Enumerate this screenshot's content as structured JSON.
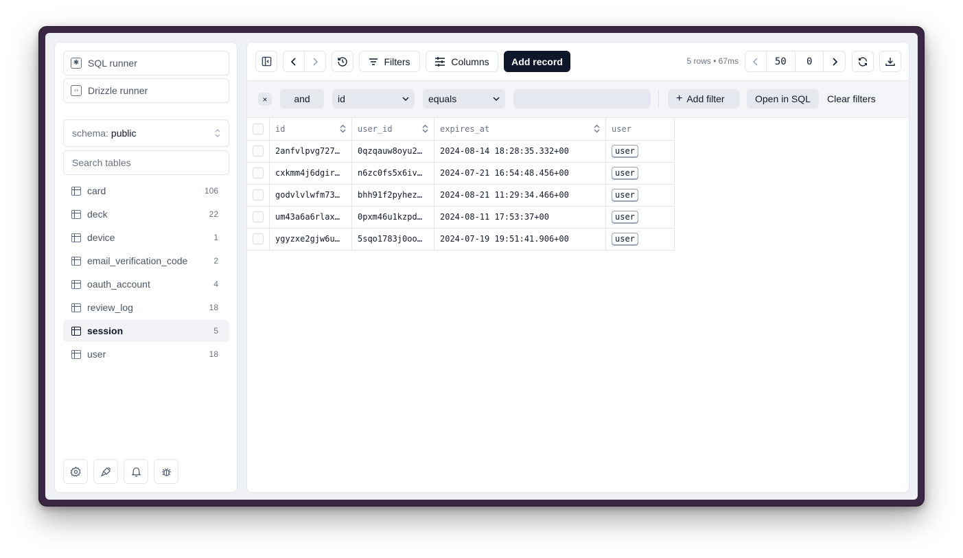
{
  "sidebar": {
    "sql_runner": "SQL runner",
    "drizzle_runner": "Drizzle runner",
    "schema_label": "schema:",
    "schema_value": "public",
    "search_placeholder": "Search tables",
    "tables": [
      {
        "name": "card",
        "count": "106",
        "active": false
      },
      {
        "name": "deck",
        "count": "22",
        "active": false
      },
      {
        "name": "device",
        "count": "1",
        "active": false
      },
      {
        "name": "email_verification_code",
        "count": "2",
        "active": false
      },
      {
        "name": "oauth_account",
        "count": "4",
        "active": false
      },
      {
        "name": "review_log",
        "count": "18",
        "active": false
      },
      {
        "name": "session",
        "count": "5",
        "active": true
      },
      {
        "name": "user",
        "count": "18",
        "active": false
      }
    ],
    "bottom_icons": [
      "settings-icon",
      "brush-icon",
      "bell-icon",
      "bug-icon"
    ]
  },
  "toolbar": {
    "filters_label": "Filters",
    "columns_label": "Columns",
    "add_record_label": "Add record",
    "status": "5 rows • 67ms",
    "limit": "50",
    "offset": "0"
  },
  "filter": {
    "conjunction": "and",
    "column": "id",
    "operator": "equals",
    "value": "",
    "add_filter_label": "Add filter",
    "open_in_sql_label": "Open in SQL",
    "clear_filters_label": "Clear filters"
  },
  "grid": {
    "columns": [
      "id",
      "user_id",
      "expires_at",
      "user"
    ],
    "rows": [
      {
        "id": "2anfvlpvg727…",
        "user_id": "0qzqauw8oyu2…",
        "expires_at": "2024-08-14 18:28:35.332+00",
        "user": "user"
      },
      {
        "id": "cxkmm4j6dgir…",
        "user_id": "n6zc0fs5x6iv…",
        "expires_at": "2024-07-21 16:54:48.456+00",
        "user": "user"
      },
      {
        "id": "godvlvlwfm73…",
        "user_id": "bhh91f2pyhez…",
        "expires_at": "2024-08-21 11:29:34.466+00",
        "user": "user"
      },
      {
        "id": "um43a6a6rlax…",
        "user_id": "0pxm46u1kzpd…",
        "expires_at": "2024-08-11 17:53:37+00",
        "user": "user"
      },
      {
        "id": "ygyzxe2gjw6u…",
        "user_id": "5sqo1783j0oo…",
        "expires_at": "2024-07-19 19:51:41.906+00",
        "user": "user"
      }
    ]
  },
  "colors": {
    "frame": "#3a2744",
    "primary": "#0f172a",
    "active_item_bg": "#f1f3f6"
  }
}
